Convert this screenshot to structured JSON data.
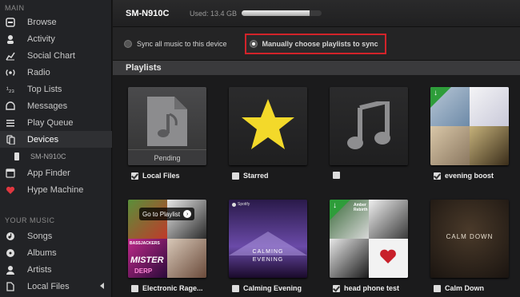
{
  "sidebar": {
    "main_title": "MAIN",
    "main_items": [
      {
        "label": "Browse",
        "icon": "browse-icon"
      },
      {
        "label": "Activity",
        "icon": "activity-icon"
      },
      {
        "label": "Social Chart",
        "icon": "chart-icon"
      },
      {
        "label": "Radio",
        "icon": "radio-icon"
      },
      {
        "label": "Top Lists",
        "icon": "top-lists-icon"
      },
      {
        "label": "Messages",
        "icon": "messages-icon"
      },
      {
        "label": "Play Queue",
        "icon": "queue-icon"
      },
      {
        "label": "Devices",
        "icon": "devices-icon",
        "active": true
      },
      {
        "label": "SM-N910C",
        "icon": "phone-icon",
        "sub": true
      },
      {
        "label": "App Finder",
        "icon": "app-finder-icon"
      },
      {
        "label": "Hype Machine",
        "icon": "hype-machine-icon"
      }
    ],
    "music_title": "YOUR MUSIC",
    "music_items": [
      {
        "label": "Songs",
        "icon": "songs-icon"
      },
      {
        "label": "Albums",
        "icon": "albums-icon"
      },
      {
        "label": "Artists",
        "icon": "artists-icon"
      },
      {
        "label": "Local Files",
        "icon": "local-files-icon"
      }
    ]
  },
  "device": {
    "name": "SM-N910C",
    "used_label": "Used: 13.4 GB",
    "usage_fraction": 0.85
  },
  "sync": {
    "option_all": "Sync all music to this device",
    "option_manual": "Manually choose playlists to sync",
    "selected": "manual"
  },
  "playlists": {
    "heading": "Playlists",
    "items": [
      {
        "name": "Local Files",
        "checked": true,
        "caption": "Pending"
      },
      {
        "name": "Starred",
        "checked": false
      },
      {
        "name": "",
        "checked": false
      },
      {
        "name": "evening boost",
        "checked": true
      },
      {
        "name": "Electronic Rage...",
        "checked": false,
        "overlay": "Go to Playlist",
        "art_text": [
          "BASSJACKERS",
          "MISTER",
          "DERP"
        ]
      },
      {
        "name": "Calming Evening",
        "checked": false,
        "art_text": [
          "Spotify",
          "CALMING",
          "EVENING"
        ]
      },
      {
        "name": "head phone test",
        "checked": true,
        "art_text": [
          "Amber",
          "Rebirth"
        ]
      },
      {
        "name": "Calm Down",
        "checked": false,
        "art_text": [
          "CALM DOWN"
        ]
      }
    ]
  }
}
